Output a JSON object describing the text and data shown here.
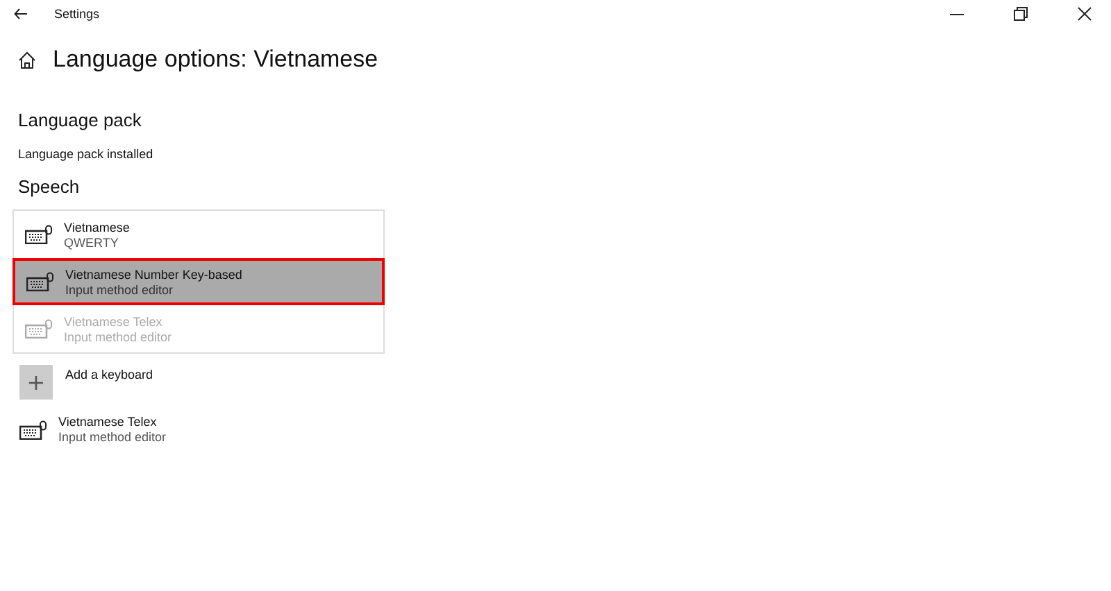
{
  "window": {
    "title": "Settings"
  },
  "page_title": "Language options: Vietnamese",
  "language_pack": {
    "heading": "Language pack",
    "status": "Language pack installed"
  },
  "speech": {
    "heading": "Speech"
  },
  "dropdown": [
    {
      "name": "Vietnamese",
      "detail": "QWERTY",
      "selected": false,
      "disabled": false
    },
    {
      "name": "Vietnamese Number Key-based",
      "detail": "Input method editor",
      "selected": true,
      "disabled": false
    },
    {
      "name": "Vietnamese Telex",
      "detail": "Input method editor",
      "selected": false,
      "disabled": true
    }
  ],
  "add_keyboard": {
    "label": "Add a keyboard",
    "icon": "+"
  },
  "keyboards": [
    {
      "name": "Vietnamese Telex",
      "detail": "Input method editor"
    }
  ]
}
